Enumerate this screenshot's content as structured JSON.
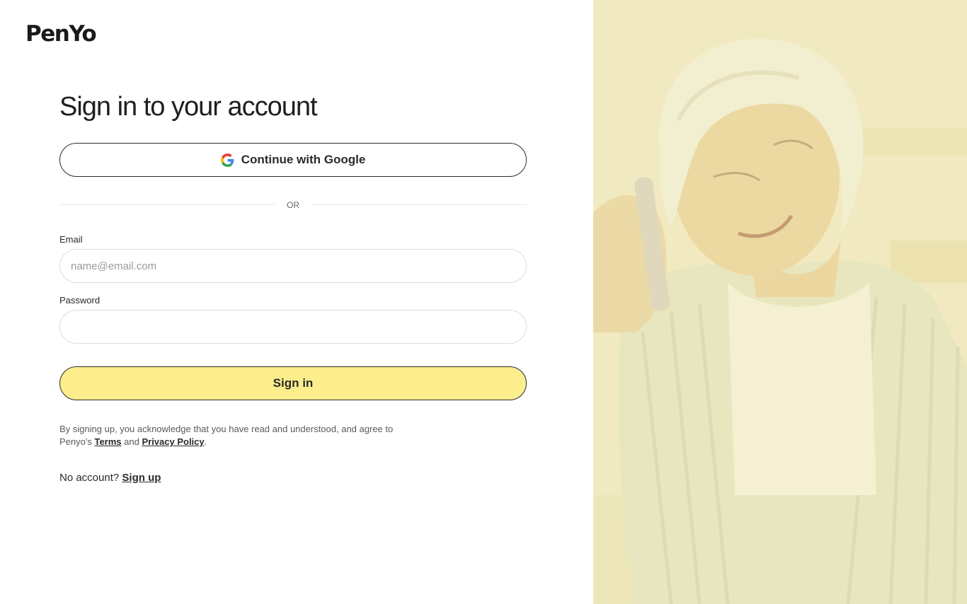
{
  "brand": {
    "logo_text": "PenYo"
  },
  "page": {
    "title": "Sign in to your account"
  },
  "google": {
    "label": "Continue with Google",
    "icon": "google-icon"
  },
  "divider": {
    "text": "OR"
  },
  "form": {
    "email_label": "Email",
    "email_placeholder": "name@email.com",
    "email_value": "",
    "password_label": "Password",
    "password_value": "",
    "submit_label": "Sign in"
  },
  "legal": {
    "text_before": "By signing up, you acknowledge that you have read and understood, and agree to Penyo's ",
    "terms_label": "Terms",
    "and_text": " and ",
    "privacy_label": "Privacy Policy",
    "text_after": "."
  },
  "signup": {
    "prompt": "No account?",
    "link_label": "Sign up"
  },
  "colors": {
    "accent": "#fcee8c",
    "text": "#1f1f1f",
    "border": "#2a2a2a",
    "photo_tint": "#efe9c2"
  }
}
